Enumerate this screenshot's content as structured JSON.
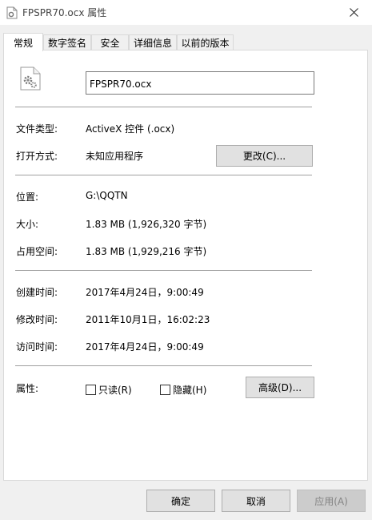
{
  "window": {
    "title": "FPSPR70.ocx 属性"
  },
  "tabs": [
    "常规",
    "数字签名",
    "安全",
    "详细信息",
    "以前的版本"
  ],
  "general": {
    "file_name": "FPSPR70.ocx",
    "type_label": "文件类型:",
    "type_value": "ActiveX 控件 (.ocx)",
    "opens_label": "打开方式:",
    "opens_value": "未知应用程序",
    "change_button": "更改(C)...",
    "location_label": "位置:",
    "location_value": "G:\\QQTN",
    "size_label": "大小:",
    "size_value": "1.83 MB (1,926,320 字节)",
    "size_on_disk_label": "占用空间:",
    "size_on_disk_value": "1.83 MB (1,929,216 字节)",
    "created_label": "创建时间:",
    "created_value": "2017年4月24日，9:00:49",
    "modified_label": "修改时间:",
    "modified_value": "2011年10月1日，16:02:23",
    "accessed_label": "访问时间:",
    "accessed_value": "2017年4月24日，9:00:49",
    "attributes_label": "属性:",
    "readonly_label": "只读(R)",
    "hidden_label": "隐藏(H)",
    "advanced_button": "高级(D)..."
  },
  "footer": {
    "ok": "确定",
    "cancel": "取消",
    "apply": "应用(A)"
  },
  "icons": {
    "title": "gear-file-icon",
    "close": "close-icon",
    "file": "gear-file-icon"
  }
}
